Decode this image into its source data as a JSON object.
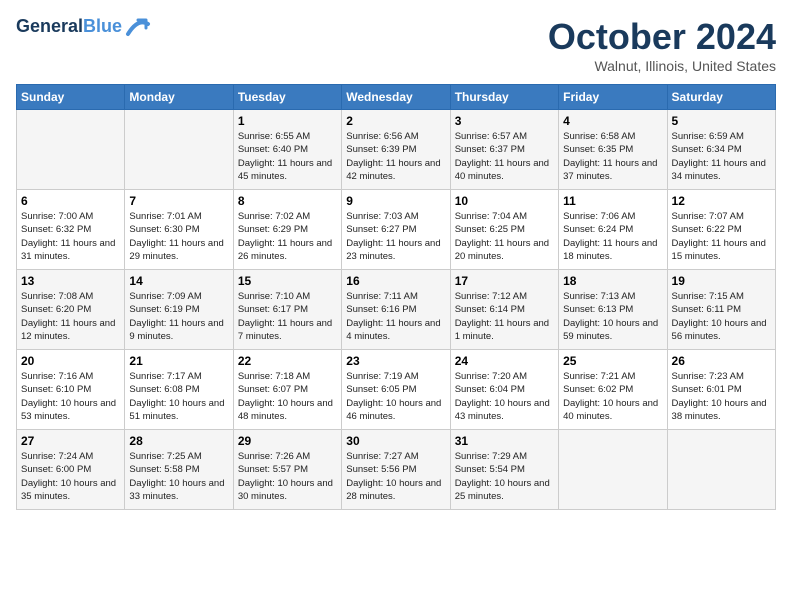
{
  "header": {
    "logo_line1": "General",
    "logo_line2": "Blue",
    "month": "October 2024",
    "location": "Walnut, Illinois, United States"
  },
  "weekdays": [
    "Sunday",
    "Monday",
    "Tuesday",
    "Wednesday",
    "Thursday",
    "Friday",
    "Saturday"
  ],
  "weeks": [
    [
      {
        "day": "",
        "sunrise": "",
        "sunset": "",
        "daylight": ""
      },
      {
        "day": "",
        "sunrise": "",
        "sunset": "",
        "daylight": ""
      },
      {
        "day": "1",
        "sunrise": "Sunrise: 6:55 AM",
        "sunset": "Sunset: 6:40 PM",
        "daylight": "Daylight: 11 hours and 45 minutes."
      },
      {
        "day": "2",
        "sunrise": "Sunrise: 6:56 AM",
        "sunset": "Sunset: 6:39 PM",
        "daylight": "Daylight: 11 hours and 42 minutes."
      },
      {
        "day": "3",
        "sunrise": "Sunrise: 6:57 AM",
        "sunset": "Sunset: 6:37 PM",
        "daylight": "Daylight: 11 hours and 40 minutes."
      },
      {
        "day": "4",
        "sunrise": "Sunrise: 6:58 AM",
        "sunset": "Sunset: 6:35 PM",
        "daylight": "Daylight: 11 hours and 37 minutes."
      },
      {
        "day": "5",
        "sunrise": "Sunrise: 6:59 AM",
        "sunset": "Sunset: 6:34 PM",
        "daylight": "Daylight: 11 hours and 34 minutes."
      }
    ],
    [
      {
        "day": "6",
        "sunrise": "Sunrise: 7:00 AM",
        "sunset": "Sunset: 6:32 PM",
        "daylight": "Daylight: 11 hours and 31 minutes."
      },
      {
        "day": "7",
        "sunrise": "Sunrise: 7:01 AM",
        "sunset": "Sunset: 6:30 PM",
        "daylight": "Daylight: 11 hours and 29 minutes."
      },
      {
        "day": "8",
        "sunrise": "Sunrise: 7:02 AM",
        "sunset": "Sunset: 6:29 PM",
        "daylight": "Daylight: 11 hours and 26 minutes."
      },
      {
        "day": "9",
        "sunrise": "Sunrise: 7:03 AM",
        "sunset": "Sunset: 6:27 PM",
        "daylight": "Daylight: 11 hours and 23 minutes."
      },
      {
        "day": "10",
        "sunrise": "Sunrise: 7:04 AM",
        "sunset": "Sunset: 6:25 PM",
        "daylight": "Daylight: 11 hours and 20 minutes."
      },
      {
        "day": "11",
        "sunrise": "Sunrise: 7:06 AM",
        "sunset": "Sunset: 6:24 PM",
        "daylight": "Daylight: 11 hours and 18 minutes."
      },
      {
        "day": "12",
        "sunrise": "Sunrise: 7:07 AM",
        "sunset": "Sunset: 6:22 PM",
        "daylight": "Daylight: 11 hours and 15 minutes."
      }
    ],
    [
      {
        "day": "13",
        "sunrise": "Sunrise: 7:08 AM",
        "sunset": "Sunset: 6:20 PM",
        "daylight": "Daylight: 11 hours and 12 minutes."
      },
      {
        "day": "14",
        "sunrise": "Sunrise: 7:09 AM",
        "sunset": "Sunset: 6:19 PM",
        "daylight": "Daylight: 11 hours and 9 minutes."
      },
      {
        "day": "15",
        "sunrise": "Sunrise: 7:10 AM",
        "sunset": "Sunset: 6:17 PM",
        "daylight": "Daylight: 11 hours and 7 minutes."
      },
      {
        "day": "16",
        "sunrise": "Sunrise: 7:11 AM",
        "sunset": "Sunset: 6:16 PM",
        "daylight": "Daylight: 11 hours and 4 minutes."
      },
      {
        "day": "17",
        "sunrise": "Sunrise: 7:12 AM",
        "sunset": "Sunset: 6:14 PM",
        "daylight": "Daylight: 11 hours and 1 minute."
      },
      {
        "day": "18",
        "sunrise": "Sunrise: 7:13 AM",
        "sunset": "Sunset: 6:13 PM",
        "daylight": "Daylight: 10 hours and 59 minutes."
      },
      {
        "day": "19",
        "sunrise": "Sunrise: 7:15 AM",
        "sunset": "Sunset: 6:11 PM",
        "daylight": "Daylight: 10 hours and 56 minutes."
      }
    ],
    [
      {
        "day": "20",
        "sunrise": "Sunrise: 7:16 AM",
        "sunset": "Sunset: 6:10 PM",
        "daylight": "Daylight: 10 hours and 53 minutes."
      },
      {
        "day": "21",
        "sunrise": "Sunrise: 7:17 AM",
        "sunset": "Sunset: 6:08 PM",
        "daylight": "Daylight: 10 hours and 51 minutes."
      },
      {
        "day": "22",
        "sunrise": "Sunrise: 7:18 AM",
        "sunset": "Sunset: 6:07 PM",
        "daylight": "Daylight: 10 hours and 48 minutes."
      },
      {
        "day": "23",
        "sunrise": "Sunrise: 7:19 AM",
        "sunset": "Sunset: 6:05 PM",
        "daylight": "Daylight: 10 hours and 46 minutes."
      },
      {
        "day": "24",
        "sunrise": "Sunrise: 7:20 AM",
        "sunset": "Sunset: 6:04 PM",
        "daylight": "Daylight: 10 hours and 43 minutes."
      },
      {
        "day": "25",
        "sunrise": "Sunrise: 7:21 AM",
        "sunset": "Sunset: 6:02 PM",
        "daylight": "Daylight: 10 hours and 40 minutes."
      },
      {
        "day": "26",
        "sunrise": "Sunrise: 7:23 AM",
        "sunset": "Sunset: 6:01 PM",
        "daylight": "Daylight: 10 hours and 38 minutes."
      }
    ],
    [
      {
        "day": "27",
        "sunrise": "Sunrise: 7:24 AM",
        "sunset": "Sunset: 6:00 PM",
        "daylight": "Daylight: 10 hours and 35 minutes."
      },
      {
        "day": "28",
        "sunrise": "Sunrise: 7:25 AM",
        "sunset": "Sunset: 5:58 PM",
        "daylight": "Daylight: 10 hours and 33 minutes."
      },
      {
        "day": "29",
        "sunrise": "Sunrise: 7:26 AM",
        "sunset": "Sunset: 5:57 PM",
        "daylight": "Daylight: 10 hours and 30 minutes."
      },
      {
        "day": "30",
        "sunrise": "Sunrise: 7:27 AM",
        "sunset": "Sunset: 5:56 PM",
        "daylight": "Daylight: 10 hours and 28 minutes."
      },
      {
        "day": "31",
        "sunrise": "Sunrise: 7:29 AM",
        "sunset": "Sunset: 5:54 PM",
        "daylight": "Daylight: 10 hours and 25 minutes."
      },
      {
        "day": "",
        "sunrise": "",
        "sunset": "",
        "daylight": ""
      },
      {
        "day": "",
        "sunrise": "",
        "sunset": "",
        "daylight": ""
      }
    ]
  ]
}
